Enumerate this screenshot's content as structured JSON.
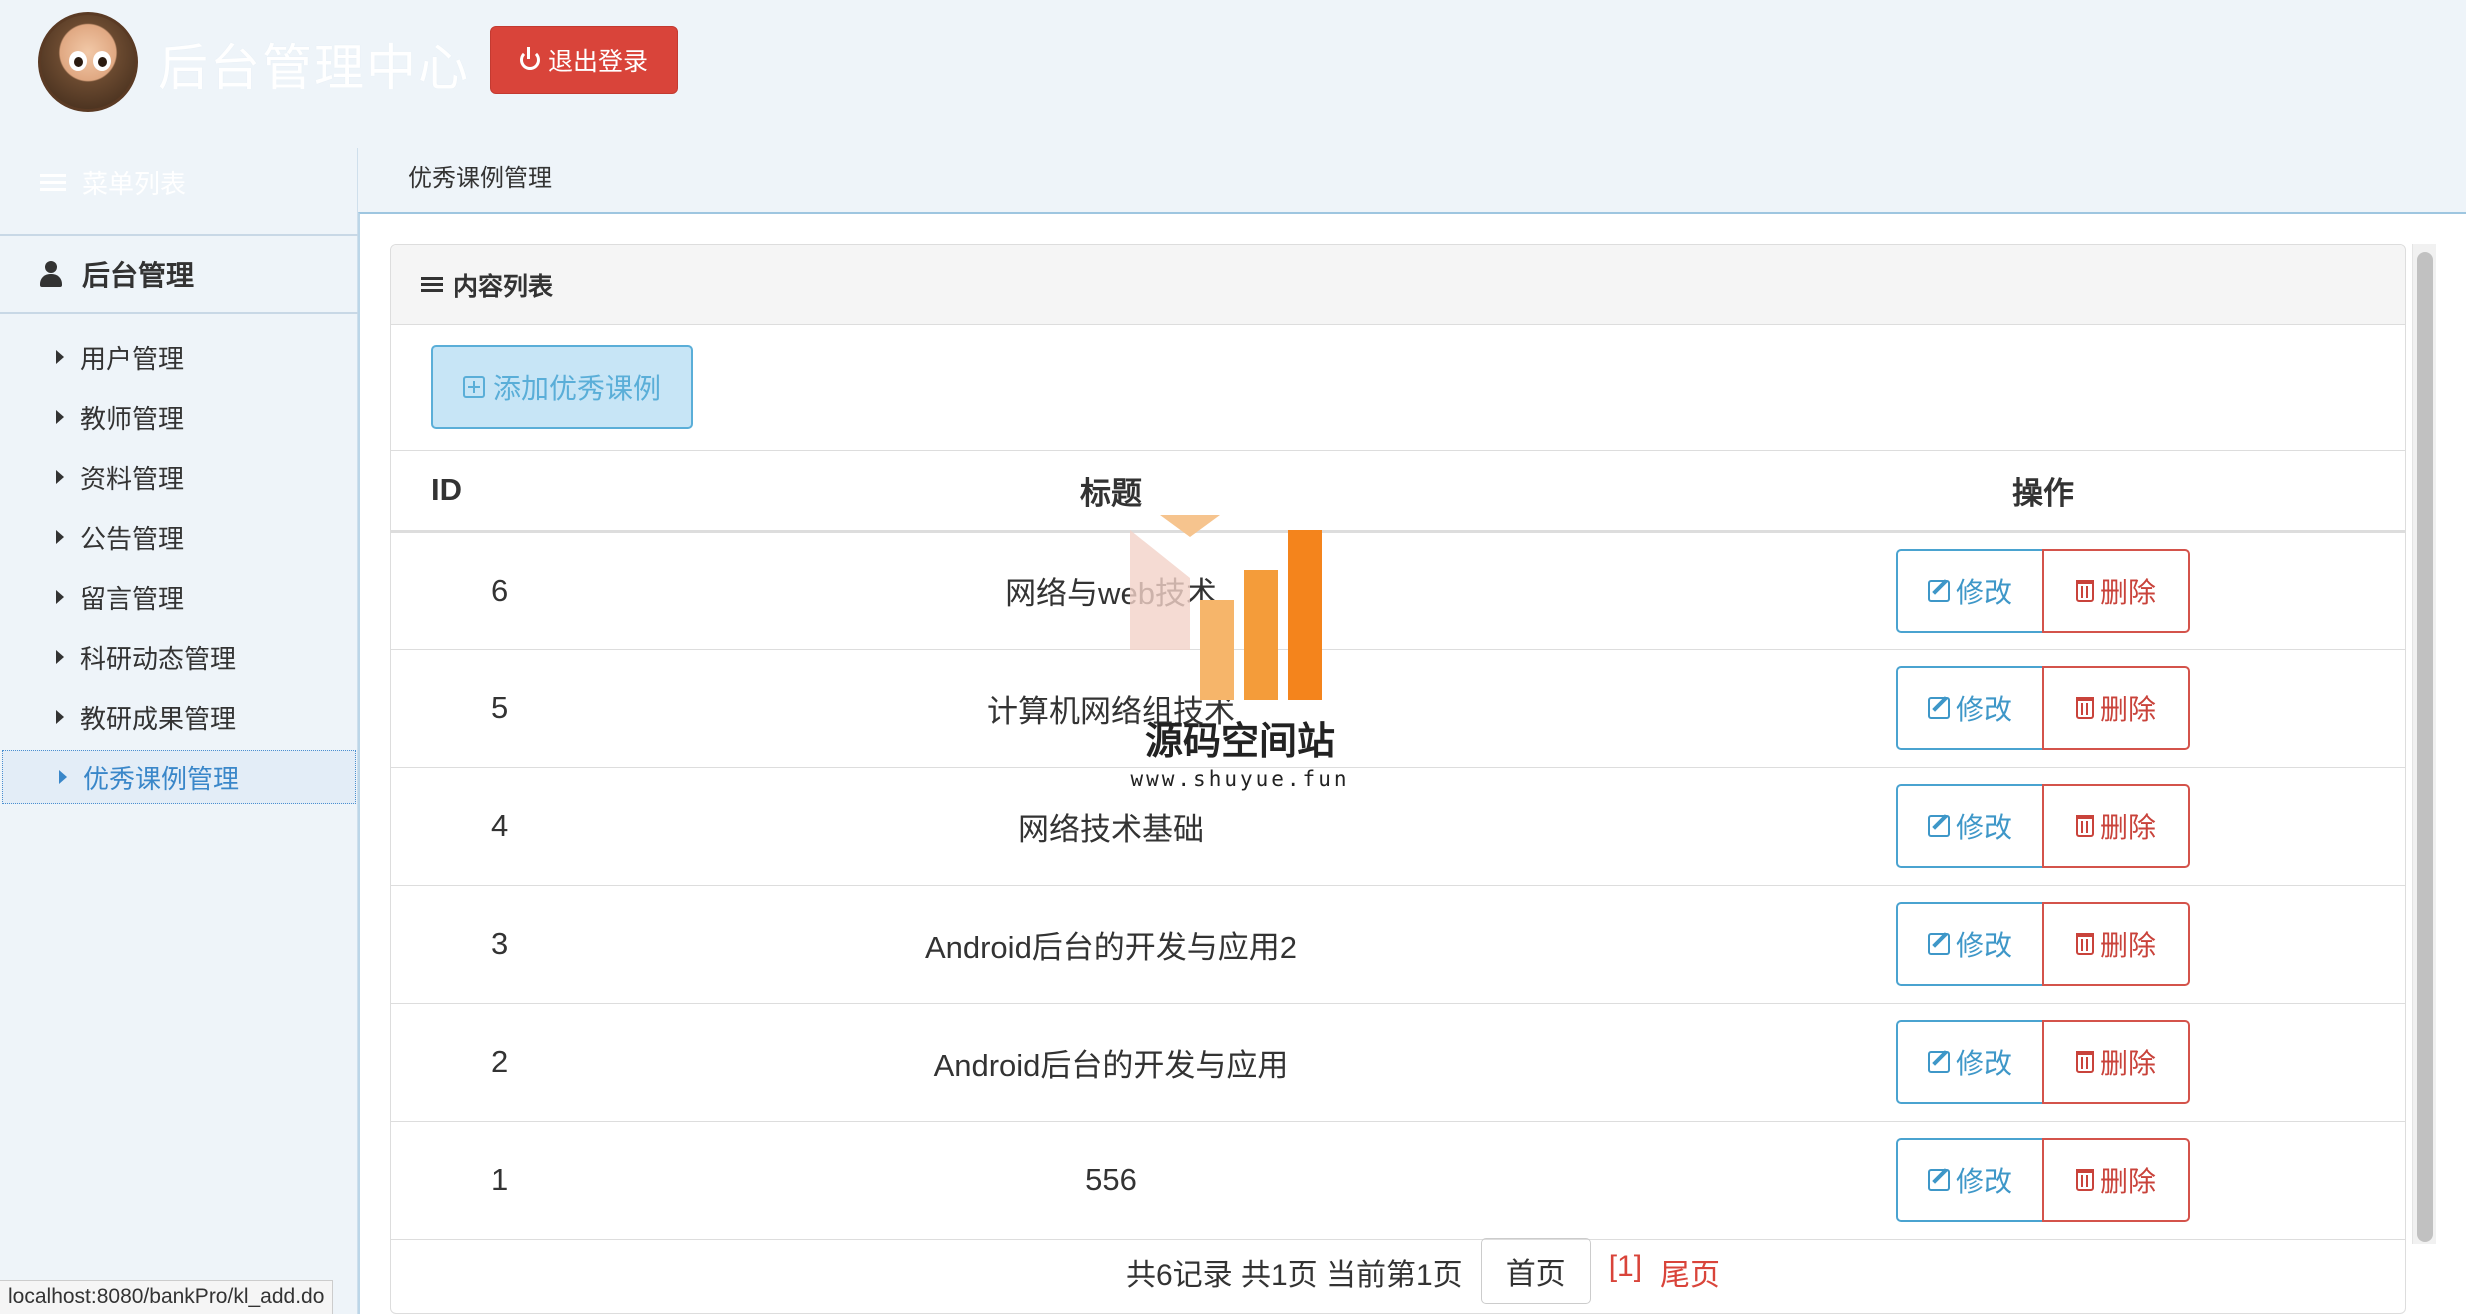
{
  "header": {
    "app_title": "后台管理中心",
    "logout_label": "退出登录",
    "menu_list_label": "菜单列表"
  },
  "breadcrumb": "优秀课例管理",
  "sidebar": {
    "section_title": "后台管理",
    "items": [
      {
        "label": "用户管理"
      },
      {
        "label": "教师管理"
      },
      {
        "label": "资料管理"
      },
      {
        "label": "公告管理"
      },
      {
        "label": "留言管理"
      },
      {
        "label": "科研动态管理"
      },
      {
        "label": "教研成果管理"
      },
      {
        "label": "优秀课例管理"
      }
    ],
    "active_index": 7
  },
  "panel": {
    "heading": "内容列表",
    "add_button_label": "添加优秀课例"
  },
  "table": {
    "columns": [
      "ID",
      "标题",
      "操作"
    ],
    "rows": [
      {
        "id": "6",
        "title": "网络与web技术"
      },
      {
        "id": "5",
        "title": "计算机网络组技术"
      },
      {
        "id": "4",
        "title": "网络技术基础"
      },
      {
        "id": "3",
        "title": "Android后台的开发与应用2"
      },
      {
        "id": "2",
        "title": "Android后台的开发与应用"
      },
      {
        "id": "1",
        "title": "556"
      }
    ],
    "edit_label": "修改",
    "delete_label": "删除"
  },
  "pager": {
    "summary": "共6记录 共1页 当前第1页",
    "first_label": "首页",
    "current_page": "[1]",
    "last_label": "尾页"
  },
  "watermark": {
    "name": "源码空间站",
    "url": "www.shuyue.fun"
  },
  "status_url": "localhost:8080/bankPro/kl_add.do",
  "colors": {
    "header_bg": "#eef4f9",
    "logout_red": "#d9443a",
    "accent_blue": "#3e97c8",
    "delete_red": "#c9433b"
  }
}
